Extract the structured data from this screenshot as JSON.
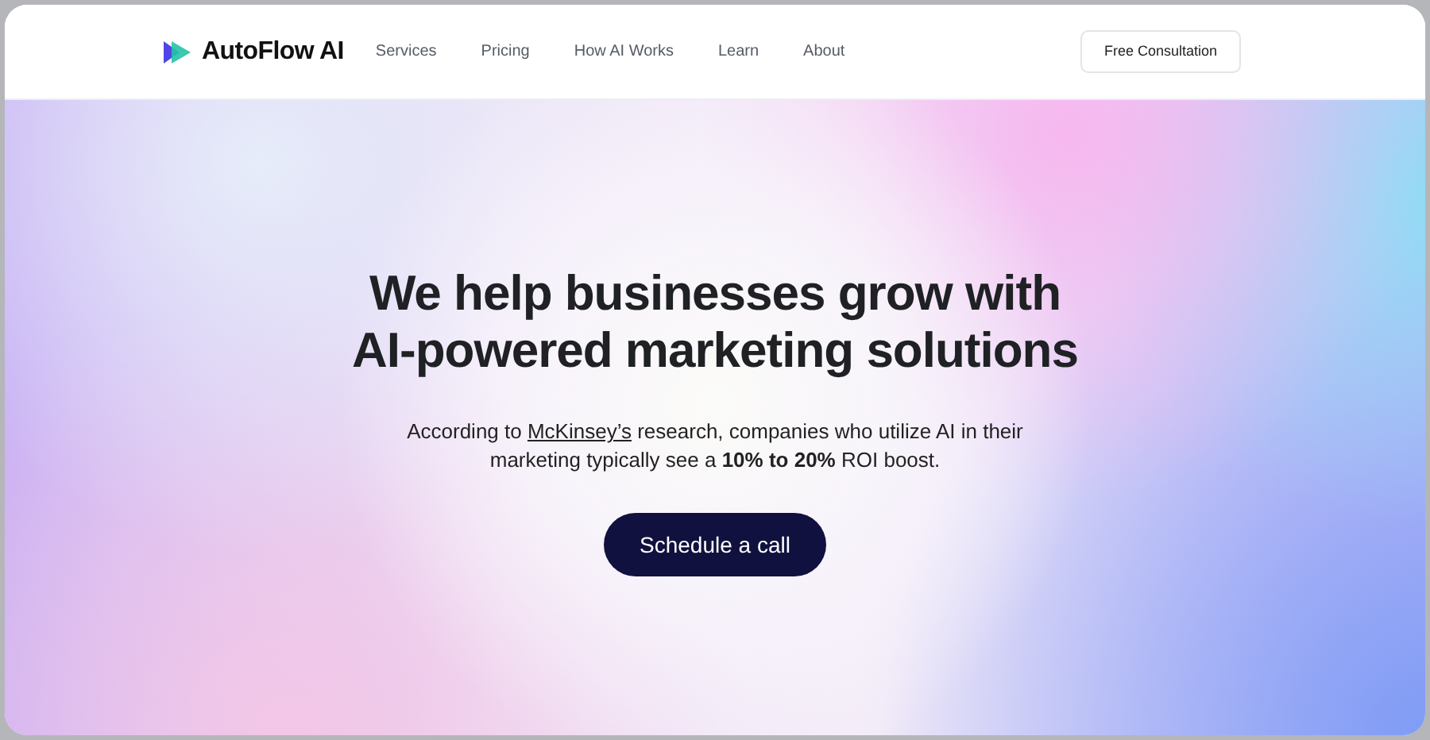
{
  "brand": {
    "name": "AutoFlow AI"
  },
  "nav": [
    {
      "label": "Services"
    },
    {
      "label": "Pricing"
    },
    {
      "label": "How AI Works"
    },
    {
      "label": "Learn"
    },
    {
      "label": "About"
    }
  ],
  "cta_button": "Free Consultation",
  "hero": {
    "title_lines": [
      "We help businesses grow with",
      "AI-powered marketing solutions"
    ],
    "description": {
      "before": "According to ",
      "link": "McKinsey’s",
      "after": " research, companies who utilize AI in their marketing typically see a **10% to 20%** ROI boost."
    },
    "button": "Schedule a call"
  }
}
